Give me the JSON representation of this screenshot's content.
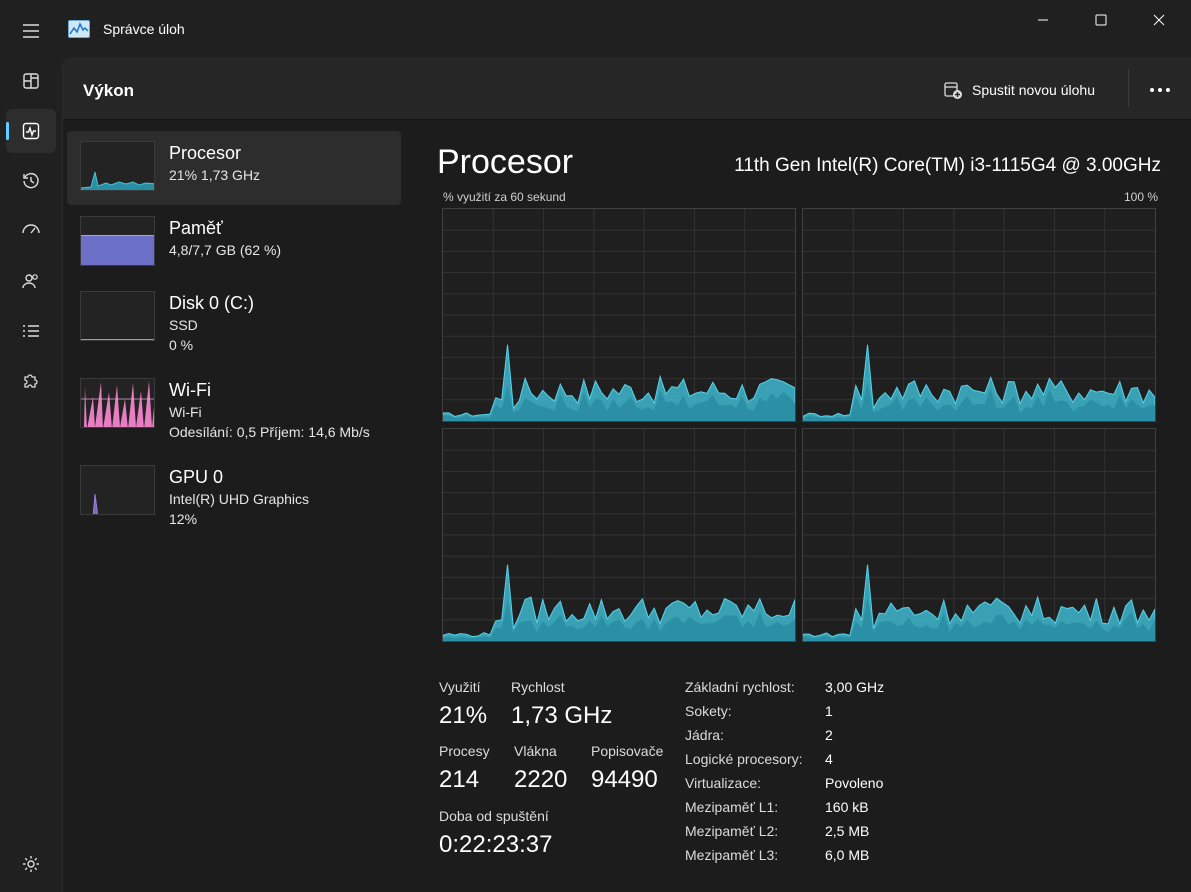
{
  "window": {
    "title": "Správce úloh"
  },
  "nav": {
    "items": [
      "hamburger",
      "processes",
      "performance",
      "app-history",
      "startup",
      "users",
      "details",
      "services"
    ],
    "active": "performance"
  },
  "header": {
    "title": "Výkon",
    "run_task_label": "Spustit novou úlohu"
  },
  "resources": [
    {
      "name": "Procesor",
      "line1": "21%  1,73 GHz",
      "line2": "",
      "color": "#4cc2d8"
    },
    {
      "name": "Paměť",
      "line1": "4,8/7,7 GB (62 %)",
      "line2": "",
      "color": "#7a7ee0"
    },
    {
      "name": "Disk 0 (C:)",
      "line1": "SSD",
      "line2": "0 %",
      "color": "#4dc4a0"
    },
    {
      "name": "Wi-Fi",
      "line1": "Wi-Fi",
      "line2": "Odesílání: 0,5  Příjem: 14,6 Mb/s",
      "color": "#f080c8"
    },
    {
      "name": "GPU 0",
      "line1": "Intel(R) UHD Graphics",
      "line2": "12%",
      "color": "#9d7fe0"
    }
  ],
  "cpu": {
    "title": "Procesor",
    "model": "11th Gen Intel(R) Core(TM) i3-1115G4 @ 3.00GHz",
    "graph_label_left": "% využití za 60 sekund",
    "graph_label_right": "100 %",
    "accent_color": "#3fb8cf"
  },
  "stats": {
    "utilization_label": "Využití",
    "utilization_value": "21%",
    "speed_label": "Rychlost",
    "speed_value": "1,73 GHz",
    "processes_label": "Procesy",
    "processes_value": "214",
    "threads_label": "Vlákna",
    "threads_value": "2220",
    "handles_label": "Popisovače",
    "handles_value": "94490",
    "uptime_label": "Doba od spuštění",
    "uptime_value": "0:22:23:37"
  },
  "details": [
    {
      "label": "Základní rychlost:",
      "value": "3,00 GHz"
    },
    {
      "label": "Sokety:",
      "value": "1"
    },
    {
      "label": "Jádra:",
      "value": "2"
    },
    {
      "label": "Logické procesory:",
      "value": "4"
    },
    {
      "label": "Virtualizace:",
      "value": "Povoleno"
    },
    {
      "label": "Mezipaměť L1:",
      "value": "160 kB"
    },
    {
      "label": "Mezipaměť L2:",
      "value": "2,5 MB"
    },
    {
      "label": "Mezipaměť L3:",
      "value": "6,0 MB"
    }
  ]
}
